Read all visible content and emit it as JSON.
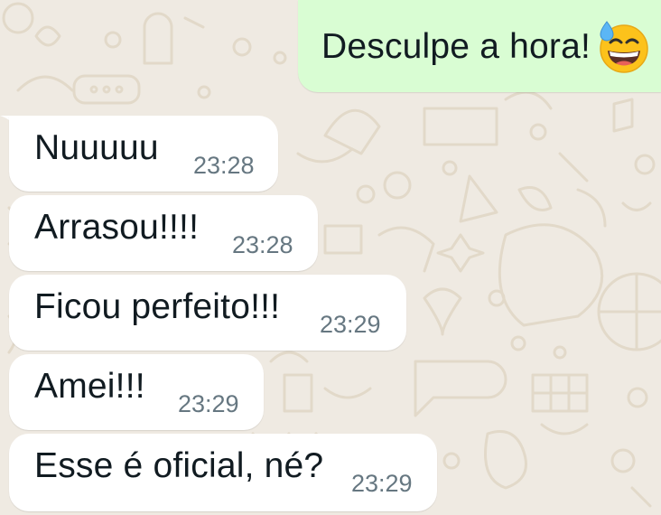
{
  "chat": {
    "outgoing": {
      "text": "Desculpe a hora!",
      "emoji": "grinning-face-with-sweat"
    },
    "incoming": [
      {
        "text": "Nuuuuu",
        "time": "23:28"
      },
      {
        "text": "Arrasou!!!!",
        "time": "23:28"
      },
      {
        "text": "Ficou perfeito!!!",
        "time": "23:29"
      },
      {
        "text": "Amei!!!",
        "time": "23:29"
      },
      {
        "text": "Esse é oficial, né?",
        "time": "23:29"
      }
    ]
  },
  "colors": {
    "background": "#efeae2",
    "incoming_bubble": "#ffffff",
    "outgoing_bubble": "#d9fdd3",
    "message_text": "#111b21",
    "timestamp": "#667781"
  }
}
